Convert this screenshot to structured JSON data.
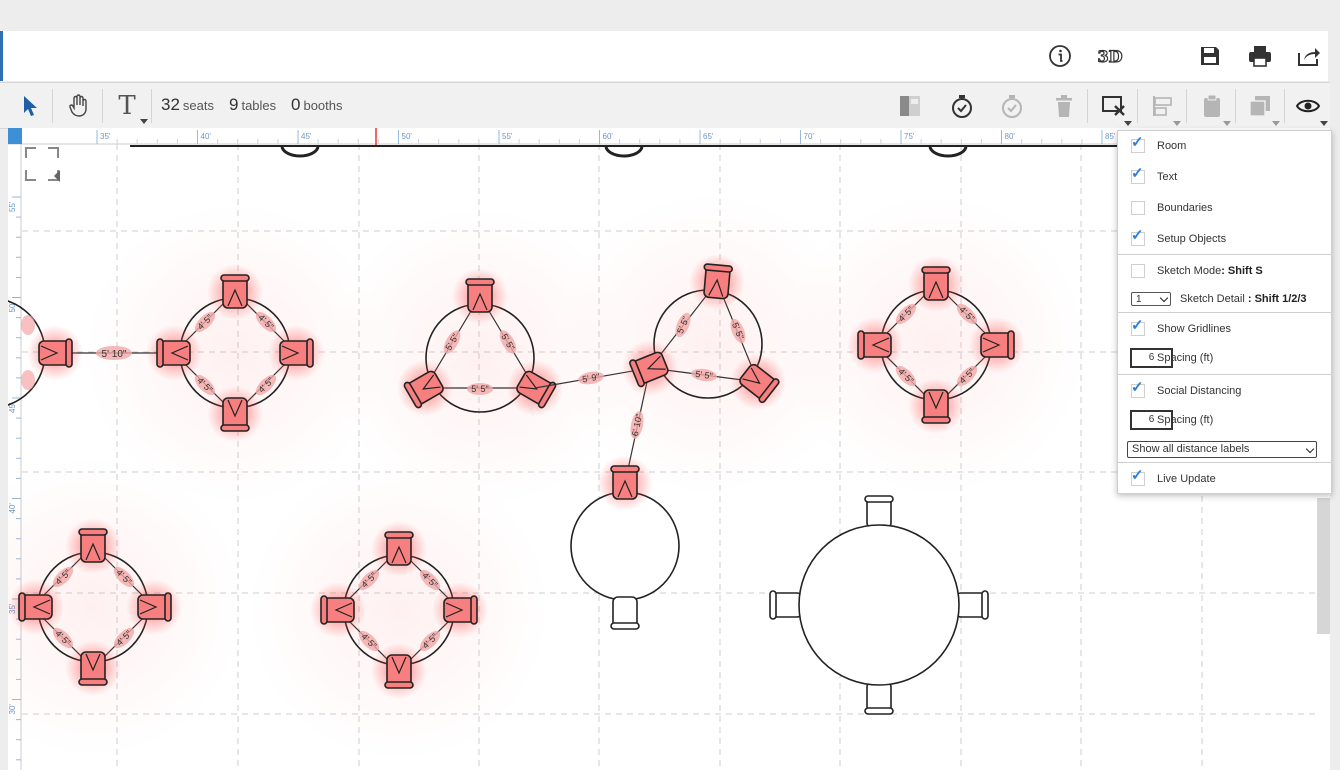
{
  "header": {
    "icons": [
      {
        "name": "info-icon"
      },
      {
        "name": "3d-view-icon",
        "text": "3D"
      },
      {
        "name": "save-icon"
      },
      {
        "name": "print-icon"
      },
      {
        "name": "share-icon"
      }
    ]
  },
  "toolbar": {
    "seats_count": "32",
    "seats_label": "seats",
    "tables_count": "9",
    "tables_label": "tables",
    "booths_count": "0",
    "booths_label": "booths"
  },
  "ruler": {
    "top_ticks": [
      "35'",
      "40'",
      "45'",
      "50'",
      "55'",
      "60'",
      "65'",
      "70'",
      "75'",
      "80'",
      "85'"
    ],
    "left_ticks": [
      "55'",
      "50'",
      "45'",
      "40'",
      "35'",
      "30'"
    ]
  },
  "floorplan": {
    "distance_labels": [
      "5' 10\"",
      "5' 5\"",
      "5' 9\"",
      "6' 10\"",
      "4' 5\""
    ],
    "seat_color": "#f77f7f",
    "highlight_color": "#ff3b3b"
  },
  "view_panel": {
    "room": {
      "label": "Room",
      "checked": true
    },
    "text": {
      "label": "Text",
      "checked": true
    },
    "boundaries": {
      "label": "Boundaries",
      "checked": false
    },
    "setup_objects": {
      "label": "Setup Objects",
      "checked": true
    },
    "sketch_mode": {
      "label": "Sketch Mode",
      "shortcut": ": Shift S",
      "checked": false
    },
    "sketch_detail": {
      "value": "1",
      "label": "Sketch Detail",
      "shortcut": " : Shift 1/2/3"
    },
    "show_gridlines": {
      "label": "Show Gridlines",
      "checked": true
    },
    "grid_spacing": {
      "value": "6",
      "label": "Spacing (ft)"
    },
    "social_distancing": {
      "label": "Social Distancing",
      "checked": true
    },
    "sd_spacing": {
      "value": "6",
      "label": "Spacing (ft)"
    },
    "distance_labels_select": "Show all distance labels",
    "live_update": {
      "label": "Live Update",
      "checked": true
    }
  },
  "accent_color": "#2f7fd5"
}
